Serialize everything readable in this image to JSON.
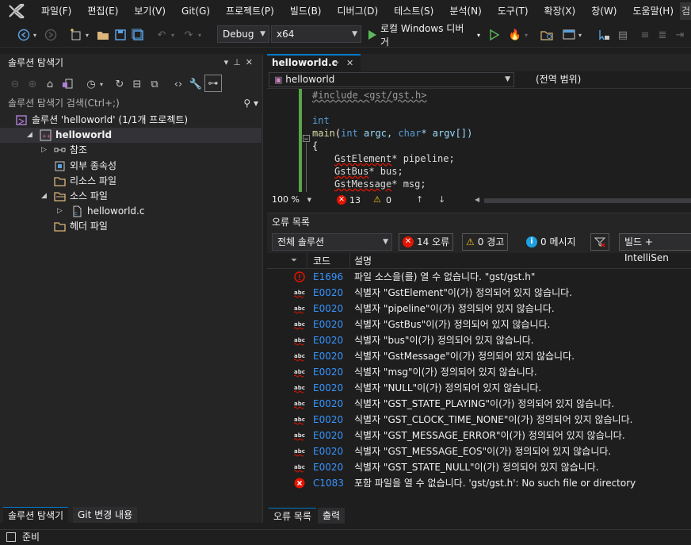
{
  "menu": {
    "items": [
      "파일(F)",
      "편집(E)",
      "보기(V)",
      "Git(G)",
      "프로젝트(P)",
      "빌드(B)",
      "디버그(D)",
      "테스트(S)",
      "분석(N)",
      "도구(T)",
      "확장(X)",
      "창(W)",
      "도움말(H)"
    ],
    "search_label": "검"
  },
  "toolbar": {
    "config": "Debug",
    "platform": "x64",
    "debug_target": "로컬 Windows 디버거"
  },
  "solution_explorer": {
    "title": "솔루션 탐색기",
    "search_placeholder": "솔루션 탐색기 검색(Ctrl+;)",
    "tree": [
      {
        "label": "솔루션 'helloworld' (1/1개 프로젝트)",
        "level": 0,
        "bold": false
      },
      {
        "label": "helloworld",
        "level": 1,
        "bold": true
      },
      {
        "label": "참조",
        "level": 2,
        "bold": false
      },
      {
        "label": "외부 종속성",
        "level": 2,
        "bold": false
      },
      {
        "label": "리소스 파일",
        "level": 2,
        "bold": false
      },
      {
        "label": "소스 파일",
        "level": 2,
        "bold": false
      },
      {
        "label": "helloworld.c",
        "level": 3,
        "bold": false
      },
      {
        "label": "헤더 파일",
        "level": 2,
        "bold": false
      }
    ],
    "tabs": [
      "솔루션 탐색기",
      "Git 변경 내용"
    ]
  },
  "editor": {
    "tab_label": "helloworld.c",
    "nav_scope": "helloworld",
    "nav_member": "(전역 범위)",
    "code": {
      "include": "#include <gst/gst.h>",
      "ret_type": "int",
      "fn_name": "main",
      "fn_open": "(",
      "kw_int": "int",
      "argc": " argc, ",
      "kw_char": "char",
      "argv": "* argv[])",
      "brace": "{",
      "l1_type": "GstElement",
      "l1_rest": "* pipeline;",
      "l2_type": "GstBus",
      "l2_rest": "* bus;",
      "l3_type": "GstMessage",
      "l3_rest": "* msg;"
    },
    "zoom": "100 %",
    "error_count": "13",
    "warning_count": "0"
  },
  "error_list": {
    "title": "오류 목록",
    "scope": "전체 솔루션",
    "errors_btn": "14 오류",
    "warnings_btn": "0 경고",
    "messages_btn": "0 메시지",
    "build_filter": "빌드 + IntelliSen",
    "col_code": "코드",
    "col_desc": "설명",
    "rows": [
      {
        "icon": "intellisense-error",
        "code": "E1696",
        "desc": "파일 소스을(를) 열 수 없습니다. \"gst/gst.h\""
      },
      {
        "icon": "abc",
        "code": "E0020",
        "desc": "식별자 \"GstElement\"이(가) 정의되어 있지 않습니다."
      },
      {
        "icon": "abc",
        "code": "E0020",
        "desc": "식별자 \"pipeline\"이(가) 정의되어 있지 않습니다."
      },
      {
        "icon": "abc",
        "code": "E0020",
        "desc": "식별자 \"GstBus\"이(가) 정의되어 있지 않습니다."
      },
      {
        "icon": "abc",
        "code": "E0020",
        "desc": "식별자 \"bus\"이(가) 정의되어 있지 않습니다."
      },
      {
        "icon": "abc",
        "code": "E0020",
        "desc": "식별자 \"GstMessage\"이(가) 정의되어 있지 않습니다."
      },
      {
        "icon": "abc",
        "code": "E0020",
        "desc": "식별자 \"msg\"이(가) 정의되어 있지 않습니다."
      },
      {
        "icon": "abc",
        "code": "E0020",
        "desc": "식별자 \"NULL\"이(가) 정의되어 있지 않습니다."
      },
      {
        "icon": "abc",
        "code": "E0020",
        "desc": "식별자 \"GST_STATE_PLAYING\"이(가) 정의되어 있지 않습니다."
      },
      {
        "icon": "abc",
        "code": "E0020",
        "desc": "식별자 \"GST_CLOCK_TIME_NONE\"이(가) 정의되어 있지 않습니다."
      },
      {
        "icon": "abc",
        "code": "E0020",
        "desc": "식별자 \"GST_MESSAGE_ERROR\"이(가) 정의되어 있지 않습니다."
      },
      {
        "icon": "abc",
        "code": "E0020",
        "desc": "식별자 \"GST_MESSAGE_EOS\"이(가) 정의되어 있지 않습니다."
      },
      {
        "icon": "abc",
        "code": "E0020",
        "desc": "식별자 \"GST_STATE_NULL\"이(가) 정의되어 있지 않습니다."
      },
      {
        "icon": "build-error",
        "code": "C1083",
        "desc": "포함 파일을 열 수 없습니다. 'gst/gst.h': No such file or directory"
      }
    ],
    "tabs": [
      "오류 목록",
      "출력"
    ]
  },
  "status": {
    "text": "준비"
  },
  "colors": {
    "accent": "#007acc",
    "error_red": "#e51400",
    "code_blue": "#3794ff",
    "keyword": "#569cd6",
    "type_green": "#4ec9b0"
  }
}
